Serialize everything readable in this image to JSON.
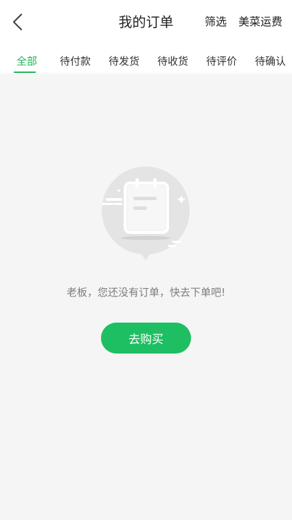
{
  "header": {
    "title": "我的订单",
    "back_icon": "chevron-left-icon",
    "filter_label": "筛选",
    "freight_label": "美菜运费"
  },
  "tabs": [
    {
      "label": "全部",
      "active": true
    },
    {
      "label": "待付款",
      "active": false
    },
    {
      "label": "待发货",
      "active": false
    },
    {
      "label": "待收货",
      "active": false
    },
    {
      "label": "待评价",
      "active": false
    },
    {
      "label": "待确认",
      "active": false
    }
  ],
  "empty_state": {
    "icon": "empty-orders-notepad-icon",
    "message": "老板，您还没有订单，快去下单吧!",
    "button_label": "去购买"
  },
  "colors": {
    "accent": "#1db35a",
    "button": "#1ebf62",
    "background": "#f5f5f5"
  }
}
